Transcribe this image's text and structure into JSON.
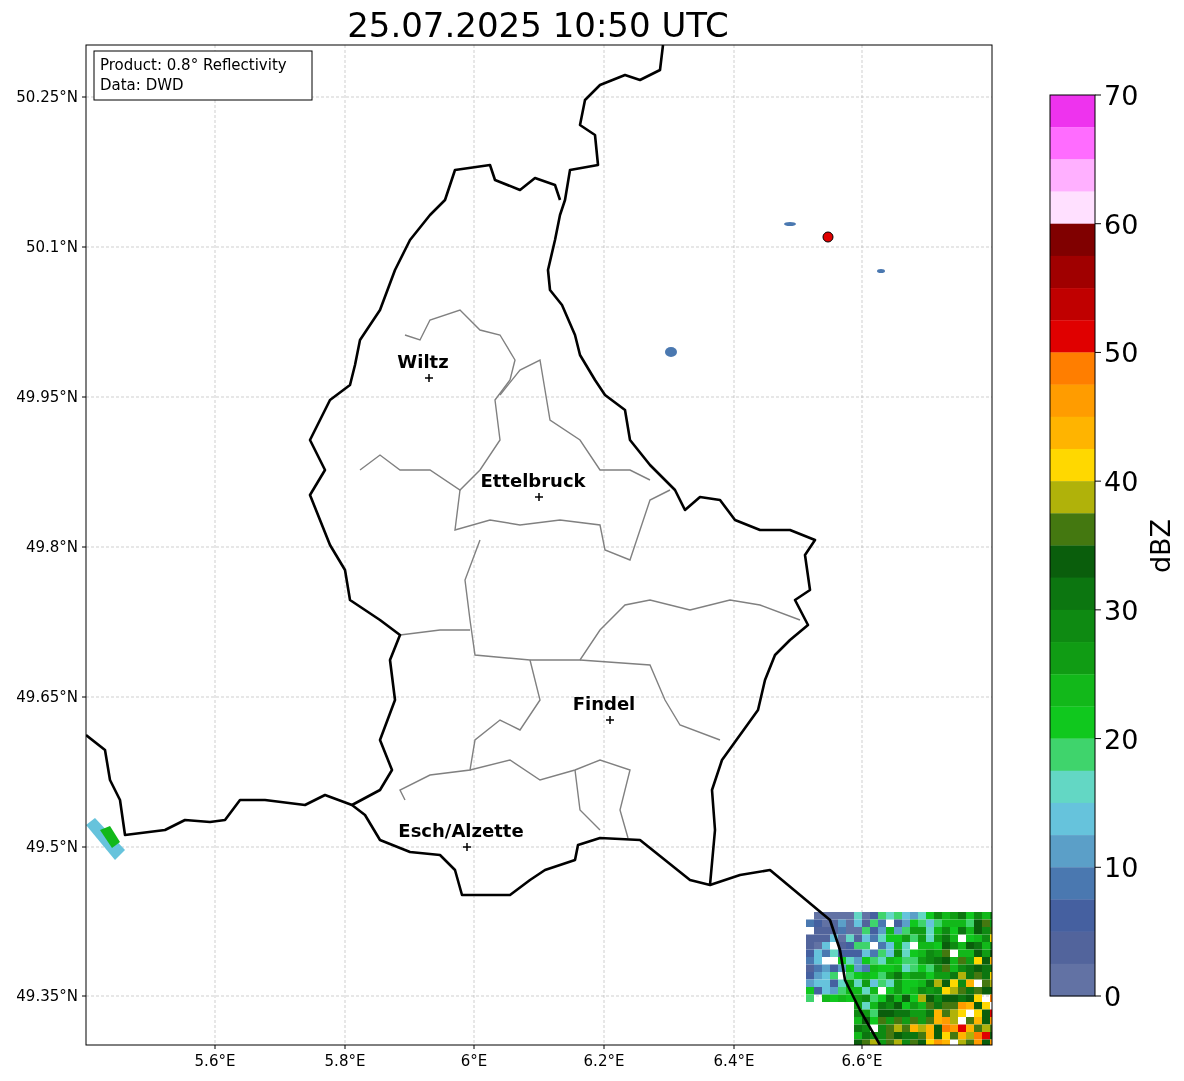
{
  "title": "25.07.2025 10:50 UTC",
  "info_box": [
    "Product: 0.8° Reflectivity",
    "Data: DWD"
  ],
  "lat_ticks": [
    "50.25°N",
    "50.1°N",
    "49.95°N",
    "49.8°N",
    "49.65°N",
    "49.5°N",
    "49.35°N"
  ],
  "lon_ticks": [
    "5.6°E",
    "5.8°E",
    "6°E",
    "6.2°E",
    "6.4°E",
    "6.6°E"
  ],
  "cities": [
    {
      "name": "Wiltz"
    },
    {
      "name": "Ettelbruck"
    },
    {
      "name": "Findel"
    },
    {
      "name": "Esch/Alzette"
    }
  ],
  "colorbar": {
    "label": "dBZ",
    "ticks": [
      "70",
      "60",
      "50",
      "40",
      "30",
      "20",
      "10",
      "0"
    ],
    "bins": [
      {
        "color": "#ee33ee"
      },
      {
        "color": "#ff6cff"
      },
      {
        "color": "#ffb0ff"
      },
      {
        "color": "#ffe0ff"
      },
      {
        "color": "#800000"
      },
      {
        "color": "#a00000"
      },
      {
        "color": "#c00000"
      },
      {
        "color": "#e00000"
      },
      {
        "color": "#ff7e00"
      },
      {
        "color": "#ff9c00"
      },
      {
        "color": "#ffb400"
      },
      {
        "color": "#ffd800"
      },
      {
        "color": "#b0b20a"
      },
      {
        "color": "#447810"
      },
      {
        "color": "#0a5e0c"
      },
      {
        "color": "#0c7610"
      },
      {
        "color": "#0e8a12"
      },
      {
        "color": "#109c14"
      },
      {
        "color": "#12b81a"
      },
      {
        "color": "#10c81e"
      },
      {
        "color": "#3fd46c"
      },
      {
        "color": "#63d7c4"
      },
      {
        "color": "#66c3dc"
      },
      {
        "color": "#5b9fc8"
      },
      {
        "color": "#4a78b0"
      },
      {
        "color": "#4560a0"
      },
      {
        "color": "#52649c"
      },
      {
        "color": "#6272a4"
      }
    ]
  }
}
